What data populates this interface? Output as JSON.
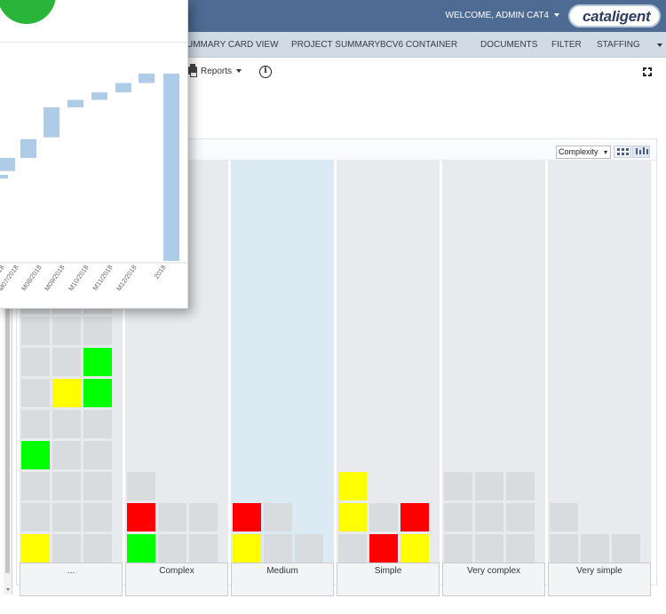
{
  "header": {
    "welcome": "WELCOME, ADMIN CAT4",
    "logo_text": "cataligent"
  },
  "nav": {
    "items": [
      "UMMARY CARD VIEW",
      "PROJECT SUMMARY",
      "BCV6 CONTAINER",
      "DOCUMENTS",
      "FILTER",
      "STAFFING"
    ]
  },
  "toolbar": {
    "reports_label": "Reports",
    "info_icon": "i"
  },
  "board": {
    "group_by": "Complexity",
    "columns": [
      {
        "label": "...",
        "highlight": false
      },
      {
        "label": "Complex",
        "highlight": false
      },
      {
        "label": "Medium",
        "highlight": true
      },
      {
        "label": "Simple",
        "highlight": false
      },
      {
        "label": "Very complex",
        "highlight": false
      },
      {
        "label": "Very simple",
        "highlight": false
      }
    ],
    "cells": [
      [
        "grey,grey,grey",
        "grey,grey,grey",
        "grey,grey,green",
        "grey,yellow,green",
        "grey,grey,grey",
        "green,grey,grey",
        "grey,grey,grey",
        "grey,grey,grey",
        "yellow,grey,grey"
      ],
      [
        "grey",
        "red,grey,grey",
        "green,grey,grey"
      ],
      [
        "red,grey",
        "yellow,grey,grey"
      ],
      [
        "yellow",
        "yellow,grey,red",
        "grey,red,yellow"
      ],
      [
        "grey,grey,grey",
        "grey,grey,grey",
        "grey,grey,grey"
      ],
      [
        "grey",
        "grey,grey,grey"
      ]
    ]
  },
  "chart_data": {
    "type": "bar",
    "subtype": "waterfall",
    "categories": [
      "018",
      "M07/2018",
      "M08/2018",
      "M09/2018",
      "M10/2018",
      "M11/2018",
      "M12/2018",
      "2018"
    ],
    "bars": [
      {
        "low": 44,
        "high": 46
      },
      {
        "low": 48,
        "high": 55
      },
      {
        "low": 55,
        "high": 65
      },
      {
        "low": 66,
        "high": 82
      },
      {
        "low": 82,
        "high": 86
      },
      {
        "low": 86,
        "high": 90
      },
      {
        "low": 90,
        "high": 95
      },
      {
        "low": 95,
        "high": 100
      },
      {
        "low": 0,
        "high": 100
      }
    ],
    "colors": {
      "bar": "#aecbe8",
      "axis": "#d8d8d8",
      "tick_text": "#666666"
    }
  }
}
